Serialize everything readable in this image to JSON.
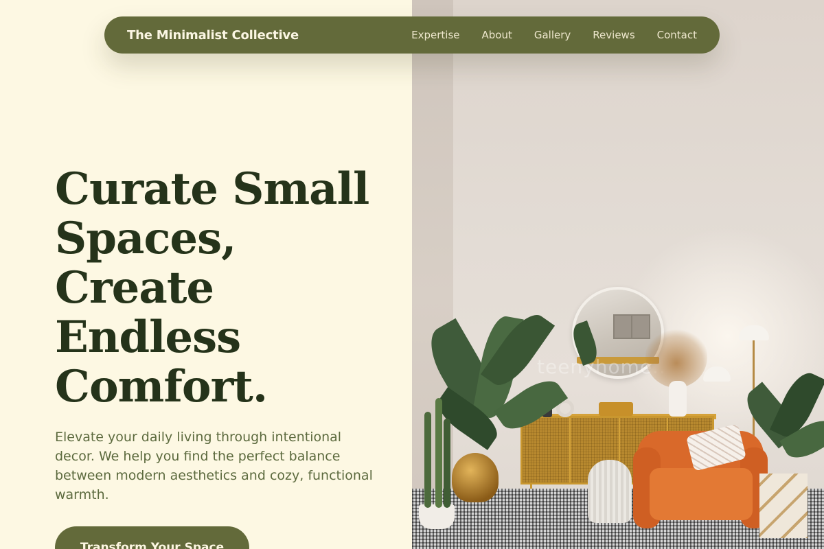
{
  "navbar": {
    "brand": "The Minimalist Collective",
    "links": [
      "Expertise",
      "About",
      "Gallery",
      "Reviews",
      "Contact"
    ]
  },
  "hero": {
    "headline_lines": [
      "Curate Small",
      "Spaces,",
      "Create",
      "Endless",
      "Comfort."
    ],
    "subtext": "Elevate your daily living through intentional decor. We help you find the perfect balance between modern aesthetics and cozy, functional warmth.",
    "cta_label": "Transform Your Space"
  },
  "image": {
    "watermark": "teenyhome.."
  },
  "colors": {
    "background": "#fdf8e3",
    "nav_bg": "#636a3a",
    "headline": "#25331a",
    "subtext": "#5c6a3e",
    "button_bg": "#636a3a"
  }
}
